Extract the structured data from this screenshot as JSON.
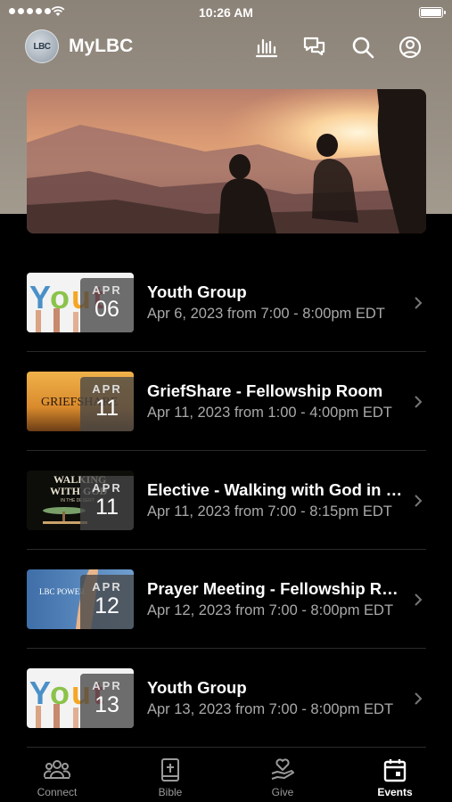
{
  "status_bar": {
    "time": "10:26 AM"
  },
  "header": {
    "avatar_text": "LBC",
    "title": "MyLBC"
  },
  "events": [
    {
      "title": "Youth Group",
      "subtitle": "Apr 6, 2023 from 7:00 - 8:00pm EDT",
      "month": "APR",
      "day": "06"
    },
    {
      "title": "GriefShare - Fellowship Room",
      "subtitle": "Apr 11, 2023 from 1:00 - 4:00pm EDT",
      "month": "APR",
      "day": "11"
    },
    {
      "title": "Elective - Walking with God in the Desert",
      "subtitle": "Apr 11, 2023 from 7:00 - 8:15pm EDT",
      "month": "APR",
      "day": "11"
    },
    {
      "title": "Prayer Meeting - Fellowship Room",
      "subtitle": "Apr 12, 2023 from 7:00 - 8:00pm EDT",
      "month": "APR",
      "day": "12"
    },
    {
      "title": "Youth Group",
      "subtitle": "Apr 13, 2023 from 7:00 - 8:00pm EDT",
      "month": "APR",
      "day": "13"
    }
  ],
  "thumbnails": {
    "grief": "GRIEFSHARE",
    "walking_line1": "WALKING",
    "walking_line2": "WITH GOD",
    "walking_line3": "IN THE DESERT",
    "prayer": "LBC POWER"
  },
  "tabs": [
    {
      "label": "Connect",
      "icon": "people-icon"
    },
    {
      "label": "Bible",
      "icon": "bible-icon"
    },
    {
      "label": "Give",
      "icon": "give-icon"
    },
    {
      "label": "Events",
      "icon": "calendar-icon",
      "active": true
    }
  ],
  "colors": {
    "background": "#000000",
    "header_bg": "#988f84",
    "subtitle": "#a9a9a9"
  }
}
